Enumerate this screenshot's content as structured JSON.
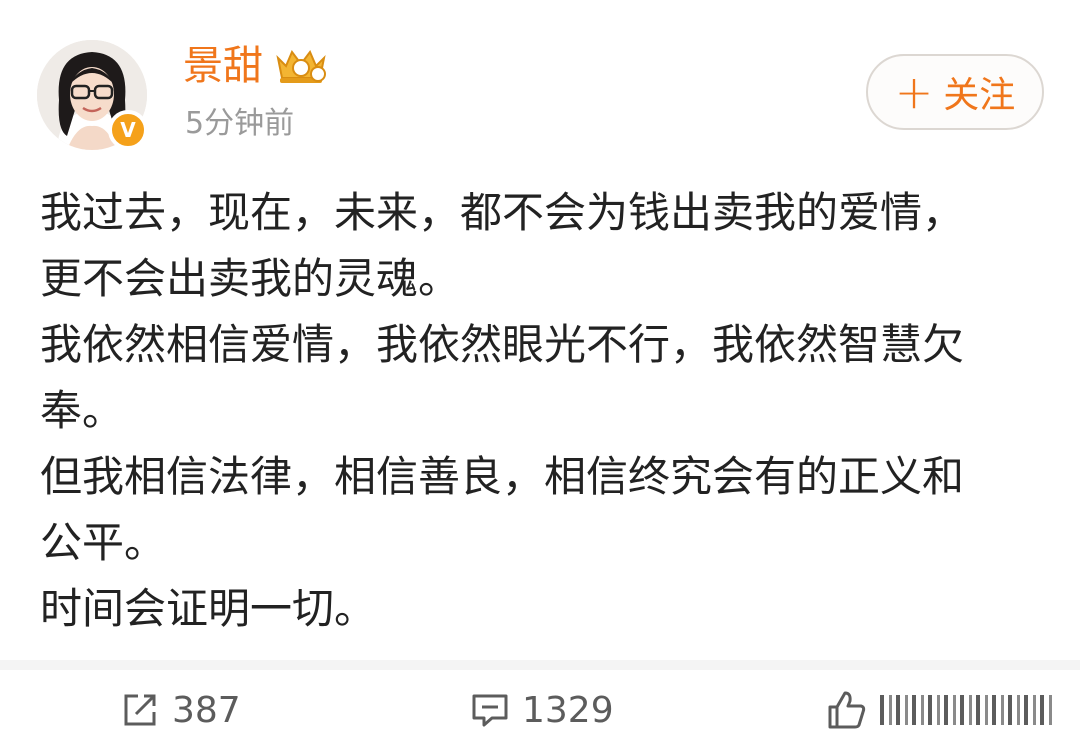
{
  "post": {
    "username": "景甜",
    "timestamp": "5分钟前",
    "follow_label": "关注",
    "follow_icon": "plus-icon",
    "verified_mark": "V",
    "content_lines": [
      "我过去，现在，未来，都不会为钱出卖我的爱情，",
      "更不会出卖我的灵魂。",
      "我依然相信爱情，我依然眼光不行，我依然智慧欠",
      "奉。",
      "但我相信法律，相信善良，相信终究会有的正义和",
      "公平。",
      "时间会证明一切。"
    ]
  },
  "actions": {
    "repost_count": "387",
    "comment_count": "1329",
    "like_count": ""
  },
  "colors": {
    "accent": "#f0761b",
    "badge": "#f5a11a",
    "text": "#222222",
    "muted": "#9a9a9a"
  }
}
